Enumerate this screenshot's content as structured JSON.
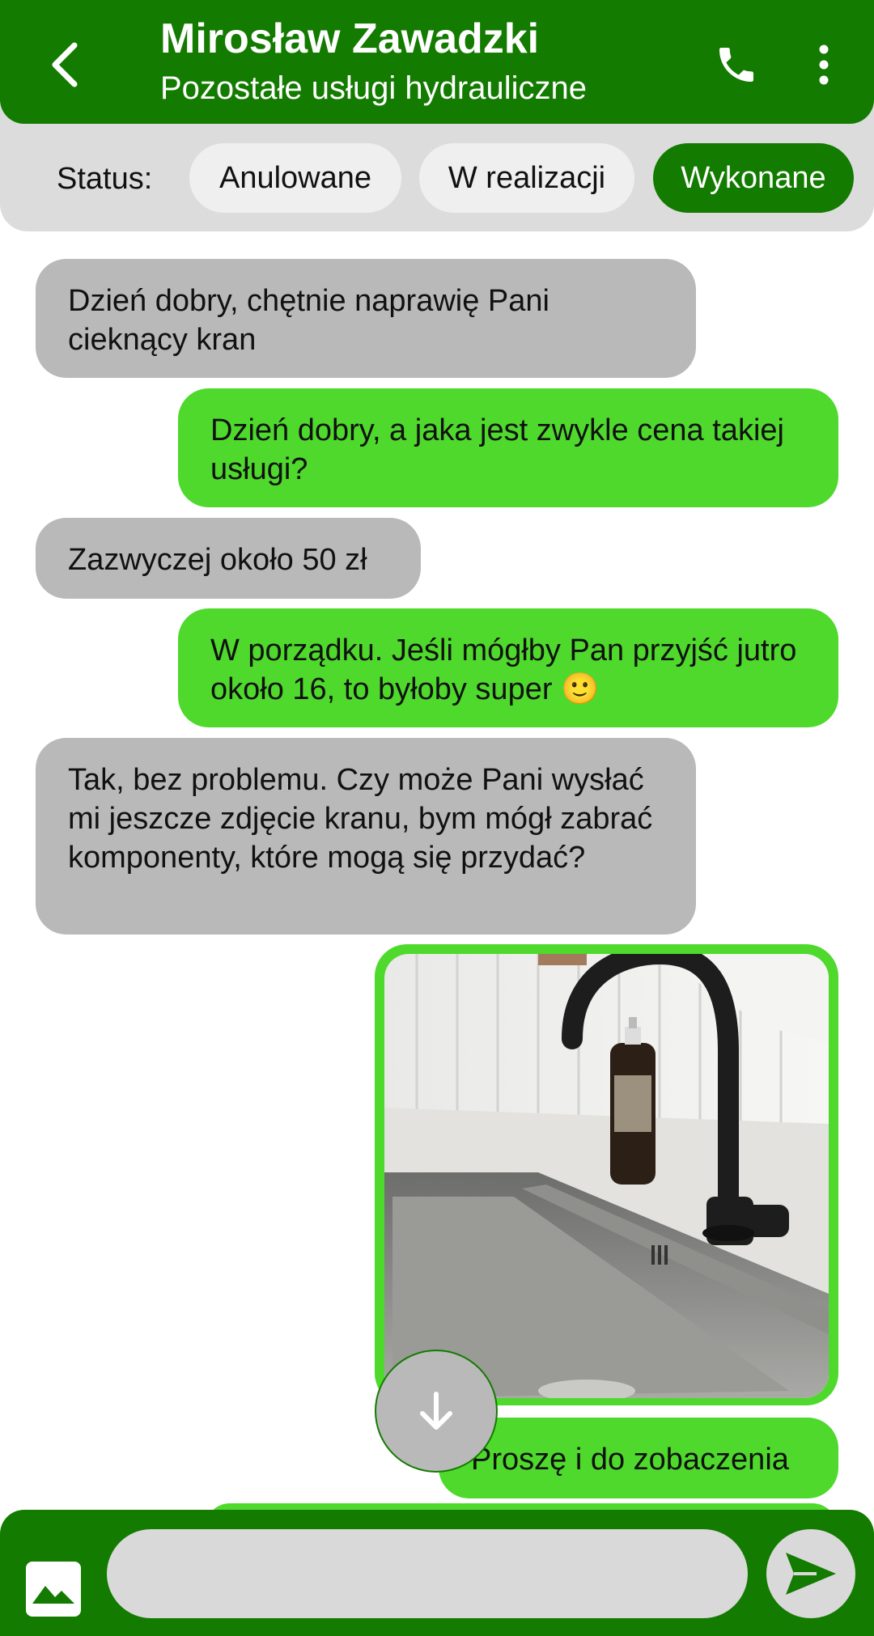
{
  "header": {
    "name": "Mirosław Zawadzki",
    "service": "Pozostałe usługi hydrauliczne",
    "icons": [
      "back-arrow-icon",
      "phone-icon",
      "more-vertical-icon"
    ],
    "color": "#137b00"
  },
  "status": {
    "label": "Status:",
    "options": [
      "Anulowane",
      "W realizacji",
      "Wykonane"
    ],
    "selected": "Wykonane"
  },
  "messages": [
    {
      "from": "them",
      "text": "Dzień dobry, chętnie naprawię Pani cieknący kran"
    },
    {
      "from": "me",
      "text": "Dzień dobry, a jaka jest zwykle cena takiej usługi?"
    },
    {
      "from": "them",
      "text": "Zazwyczej około 50 zł"
    },
    {
      "from": "me",
      "text": "W porządku. Jeśli mógłby Pan przyjść jutro około 16, to byłoby super 🙂"
    },
    {
      "from": "them",
      "text": "Tak, bez problemu. Czy może Pani wysłać mi jeszcze zdjęcie kranu, bym mógł zabrać komponenty, które mogą się przydać?"
    },
    {
      "from": "me",
      "type": "image",
      "image": "kitchen-sink-faucet-photo"
    },
    {
      "from": "me",
      "text": "Proszę i do zobaczenia"
    }
  ],
  "composer": {
    "placeholder": "",
    "icons": [
      "image-icon",
      "send-icon"
    ]
  },
  "colors": {
    "dark_green": "#137b00",
    "bubble_out": "#4ed92c",
    "bubble_in": "#b9b9b9",
    "status_bg": "#dcdcdc"
  }
}
